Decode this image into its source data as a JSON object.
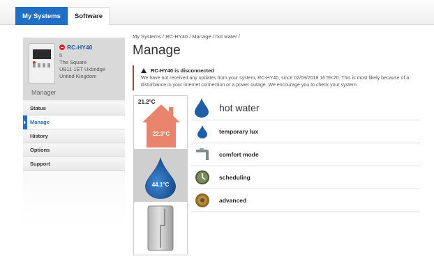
{
  "tabs": [
    {
      "label": "My Systems",
      "active": true
    },
    {
      "label": "Software",
      "active": false
    }
  ],
  "device": {
    "name": "RC-HY40",
    "number": "5",
    "address1": "The Square",
    "address2": "UB11 1ET Uxbridge",
    "country": "United Kingdom",
    "role": "Manager",
    "status_icon": "disconnected-icon"
  },
  "nav": [
    {
      "label": "Status",
      "active": false
    },
    {
      "label": "Manage",
      "active": true
    },
    {
      "label": "History",
      "active": false
    },
    {
      "label": "Options",
      "active": false
    },
    {
      "label": "Support",
      "active": false
    }
  ],
  "breadcrumb": "My Systems / RC-HY40 / Manage / hot water /",
  "page_title": "Manage",
  "alert": {
    "title": "RC-HY40 is disconnected",
    "text": "We have not received any updates from your system, RC-HY40, since 02/03/2018 16:59:20. This is most likely because of a disturbance in your internet connection or a power outage. We encourage you to check your system."
  },
  "visual": {
    "outside_temp": "21.2°C",
    "house_temp": "22.3°C",
    "tank_temp": "44.1°C"
  },
  "menu": {
    "title": "hot water",
    "items": [
      {
        "label": "temporary lux",
        "icon": "water-drop-icon"
      },
      {
        "label": "comfort mode",
        "icon": "faucet-icon"
      },
      {
        "label": "scheduling",
        "icon": "clock-icon"
      },
      {
        "label": "advanced",
        "icon": "gear-icon"
      }
    ]
  },
  "colors": {
    "accent": "#1f6fc4",
    "house": "#e9836b",
    "water": "#1e5fa8",
    "alert_border": "#c0392b"
  }
}
